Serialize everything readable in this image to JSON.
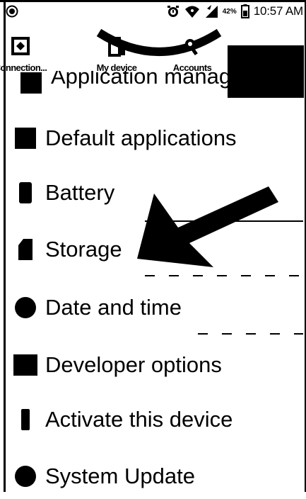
{
  "status_bar": {
    "time": "10:57 AM",
    "battery_text": "42%",
    "icons": [
      "notification-icon",
      "alarm-icon",
      "wifi-icon",
      "signal-icon",
      "battery-icon"
    ]
  },
  "tabs": [
    {
      "label": "Connection...",
      "icon": "connections-icon"
    },
    {
      "label": "My device",
      "icon": "my-device-icon"
    },
    {
      "label": "Accounts",
      "icon": "accounts-icon"
    }
  ],
  "settings": {
    "partial_item": "Application manager",
    "items": [
      {
        "label": "Default applications",
        "icon": "square-icon"
      },
      {
        "label": "Battery",
        "icon": "battery-icon"
      },
      {
        "label": "Storage",
        "icon": "sd-card-icon"
      },
      {
        "label": "Date and time",
        "icon": "clock-icon"
      },
      {
        "label": "Developer options",
        "icon": "developer-icon"
      },
      {
        "label": "Activate this device",
        "icon": "phone-icon"
      },
      {
        "label": "System Update",
        "icon": "update-icon"
      }
    ]
  },
  "colors": {
    "foreground": "#000000",
    "background": "#ffffff"
  }
}
